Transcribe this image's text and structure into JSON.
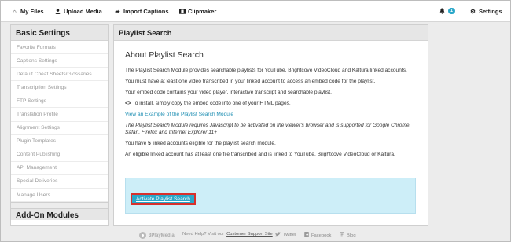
{
  "topnav": {
    "my_files": "My Files",
    "upload_media": "Upload Media",
    "import_captions": "Import Captions",
    "clipmaker": "Clipmaker",
    "notifications_count": "1",
    "settings": "Settings",
    "icons": [
      "home-icon",
      "user-icon",
      "arrow-icon",
      "film-icon",
      "bell-icon",
      "gear-icon"
    ]
  },
  "sidebar": {
    "title": "Basic Settings",
    "items": [
      "Favorite Formats",
      "Captions Settings",
      "Default Cheat Sheets/Glossaries",
      "Transcription Settings",
      "FTP Settings",
      "Translation Profile",
      "Alignment Settings",
      "Plugin Templates",
      "Content Publishing",
      "API Management",
      "Special Deliveries",
      "Manage Users"
    ],
    "section2_title": "Add-On Modules"
  },
  "panel": {
    "title": "Playlist Search",
    "heading": "About Playlist Search",
    "p1": "The Playlist Search Module provides searchable playlists for YouTube, Brightcove VideoCloud and Kaltura linked accounts.",
    "p2": "You must have at least one video transcribed in your linked account to access an embed code for the playlist.",
    "p3": "Your embed code contains your video player, interactive transcript and searchable playlist.",
    "p4_icon": "<>",
    "p4": "To install, simply copy the embed code into one of your HTML pages.",
    "example_link": "View an Example of the Playlist Search Module",
    "p5": "The Playlist Search Module requires Javascript to be activated on the viewer's browser and is supported for Google Chrome, Safari, Firefox and Internet Explorer 11+",
    "p6_pre": "You have ",
    "p6_count": "5",
    "p6_post": " linked accounts eligible for the playlist search module.",
    "p7": "An eligible linked account has at least one file transcribed and is linked to YouTube, Brightcove VideoCloud or Kaltura.",
    "activate_button": "Activate Playlist Search"
  },
  "footer": {
    "brand": "3PlayMedia",
    "help_text": "Need Help? Visit our ",
    "help_link": "Customer Support Site",
    "twitter": "Twitter",
    "facebook": "Facebook",
    "blog": "Blog"
  },
  "colors": {
    "accent": "#2aa7c9",
    "link": "#1f8fb3",
    "callout_bg": "#cdeef8",
    "button_outline": "#d9302c"
  }
}
